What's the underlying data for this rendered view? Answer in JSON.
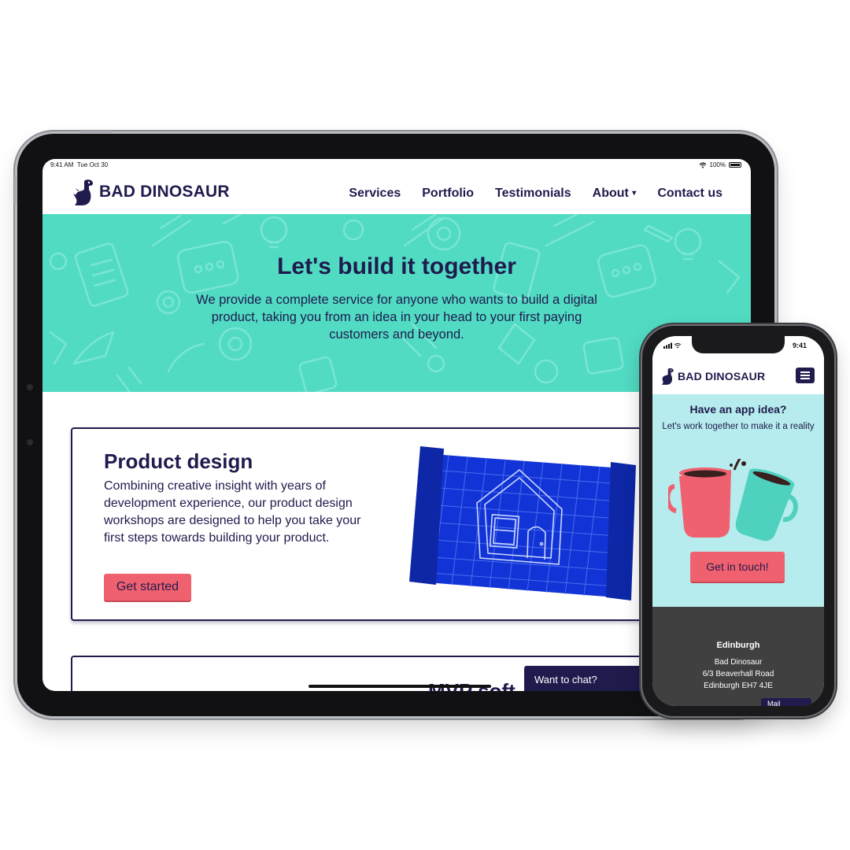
{
  "tablet": {
    "status": {
      "time": "9:41 AM",
      "date": "Tue Oct 30",
      "battery": "100%"
    },
    "brand": "BAD DINOSAUR",
    "nav": {
      "services": "Services",
      "portfolio": "Portfolio",
      "testimonials": "Testimonials",
      "about": "About",
      "contact": "Contact us"
    },
    "hero": {
      "title": "Let's build it together",
      "text": "We provide a complete service for anyone who wants to build a digital product, taking you from an idea in your head to your first paying customers and beyond."
    },
    "card": {
      "title": "Product design",
      "text": "Combining creative insight with years of development experience, our product design workshops are designed to help you take your first steps towards building your product.",
      "button": "Get started"
    },
    "card2": {
      "title": "MVP soft"
    },
    "chat": "Want to chat?"
  },
  "phone": {
    "status": {
      "time": "9:41"
    },
    "brand": "BAD DINOSAUR",
    "hero": {
      "title": "Have an app idea?",
      "text": "Let's work together to make it a reality",
      "button": "Get in touch!"
    },
    "footer": {
      "city": "Edinburgh",
      "line1": "Bad Dinosaur",
      "line2": "6/3 Beaverhall Road",
      "line3": "Edinburgh EH7 4JE"
    },
    "mail": "Mail"
  },
  "colors": {
    "navy": "#1f1b4d",
    "teal": "#51dbc3",
    "light_teal": "#b6eced",
    "coral": "#f0616f",
    "footer": "#404040",
    "blueprint": "#1234d6"
  }
}
